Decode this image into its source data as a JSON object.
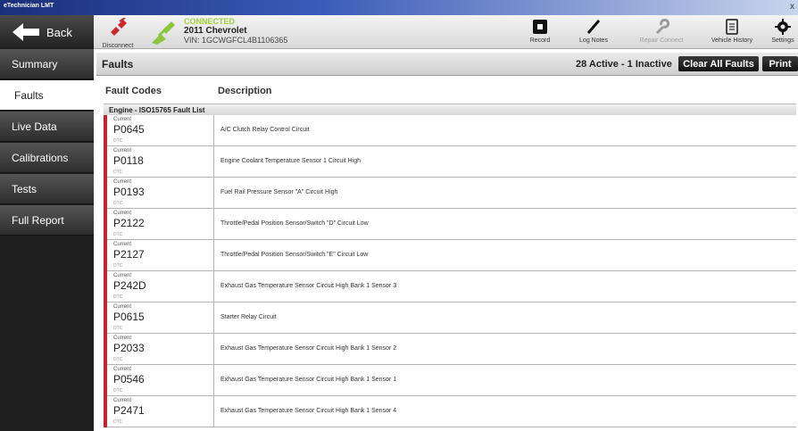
{
  "window": {
    "title": "eTechnician LMT",
    "close": "x"
  },
  "toolbar": {
    "back_label": "Back",
    "disconnect_label": "Disconnect",
    "connection_status": "CONNECTED",
    "vehicle_model": "2011 Chevrolet",
    "vin": "VIN: 1GCWGFCL4B1106365",
    "tools": [
      {
        "label": "Record",
        "icon": "record-icon"
      },
      {
        "label": "Log Notes",
        "icon": "pen-icon"
      },
      {
        "label": "Repair Connect",
        "icon": "wrench-icon"
      },
      {
        "label": "Vehicle History",
        "icon": "document-icon"
      },
      {
        "label": "Settings",
        "icon": "gear-icon"
      }
    ]
  },
  "sidebar": {
    "items": [
      {
        "label": "Summary"
      },
      {
        "label": "Faults"
      },
      {
        "label": "Live Data"
      },
      {
        "label": "Calibrations"
      },
      {
        "label": "Tests"
      },
      {
        "label": "Full Report"
      }
    ]
  },
  "main": {
    "title": "Faults",
    "counts": "28 Active - 1 Inactive",
    "clear_all_label": "Clear All Faults",
    "print_label": "Print",
    "col_codes": "Fault Codes",
    "col_desc": "Description",
    "group_title": "Engine - ISO15765 Fault List",
    "faults": [
      {
        "status": "Current",
        "code": "P0645",
        "type": "DTC",
        "description": "A/C Clutch Relay Control Circuit"
      },
      {
        "status": "Current",
        "code": "P0118",
        "type": "DTC",
        "description": "Engine Coolant Temperature Sensor 1 Circuit High"
      },
      {
        "status": "Current",
        "code": "P0193",
        "type": "DTC",
        "description": "Fuel Rail Pressure Sensor \"A\" Circuit High"
      },
      {
        "status": "Current",
        "code": "P2122",
        "type": "DTC",
        "description": "Throttle/Pedal Position Sensor/Switch \"D\" Circuit Low"
      },
      {
        "status": "Current",
        "code": "P2127",
        "type": "DTC",
        "description": "Throttle/Pedal Position Sensor/Switch \"E\" Circuit Low"
      },
      {
        "status": "Current",
        "code": "P242D",
        "type": "DTC",
        "description": "Exhaust Gas Temperature Sensor Circuit High Bank 1 Sensor 3"
      },
      {
        "status": "Current",
        "code": "P0615",
        "type": "DTC",
        "description": "Starter Relay Circuit"
      },
      {
        "status": "Current",
        "code": "P2033",
        "type": "DTC",
        "description": "Exhaust Gas Temperature Sensor Circuit High Bank 1 Sensor 2"
      },
      {
        "status": "Current",
        "code": "P0546",
        "type": "DTC",
        "description": "Exhaust Gas Temperature Sensor Circuit High Bank 1 Sensor 1"
      },
      {
        "status": "Current",
        "code": "P2471",
        "type": "DTC",
        "description": "Exhaust Gas Temperature Sensor Circuit High Bank 1 Sensor 4"
      }
    ]
  },
  "colors": {
    "accent_red": "#c8232c",
    "connected_green": "#9ed23a"
  }
}
